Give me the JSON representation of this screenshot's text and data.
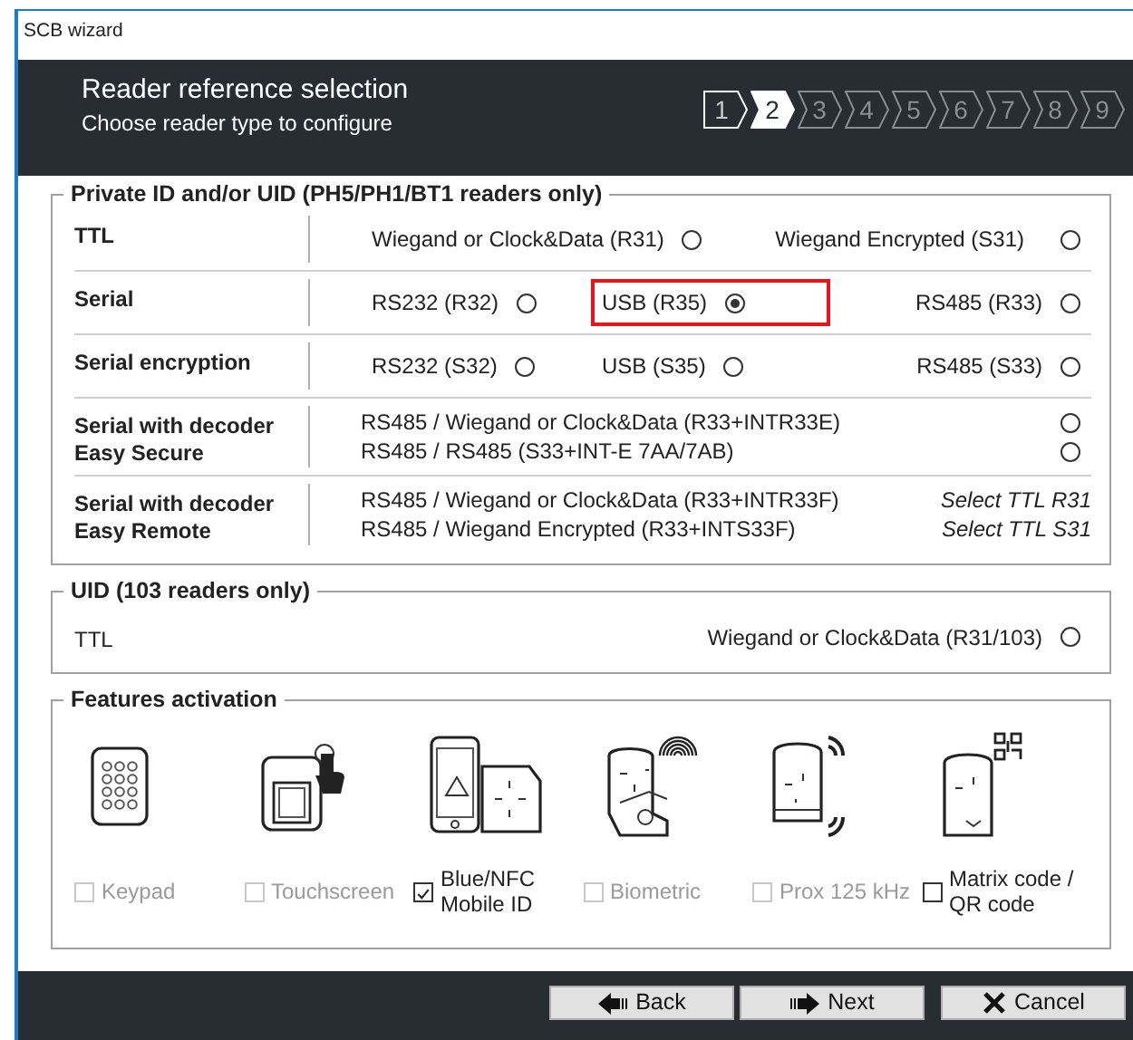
{
  "window": {
    "title": "SCB wizard"
  },
  "header": {
    "title": "Reader reference selection",
    "subtitle": "Choose reader type to configure",
    "steps": [
      {
        "label": "1",
        "completed": true,
        "selected": false
      },
      {
        "label": "2",
        "completed": false,
        "selected": true
      },
      {
        "label": "3",
        "completed": false,
        "selected": false
      },
      {
        "label": "4",
        "completed": false,
        "selected": false
      },
      {
        "label": "5",
        "completed": false,
        "selected": false
      },
      {
        "label": "6",
        "completed": false,
        "selected": false
      },
      {
        "label": "7",
        "completed": false,
        "selected": false
      },
      {
        "label": "8",
        "completed": false,
        "selected": false
      },
      {
        "label": "9",
        "completed": false,
        "selected": false
      }
    ]
  },
  "private_group": {
    "title": "Private ID and/or UID (PH5/PH1/BT1 readers only)",
    "rows": [
      {
        "kind": "inline",
        "label": "TTL",
        "options": [
          {
            "kind": "radio",
            "label": "Wiegand or Clock&Data (R31)",
            "selected": false
          },
          {
            "kind": "radio",
            "label": "Wiegand Encrypted (S31)",
            "selected": false
          }
        ]
      },
      {
        "kind": "inline",
        "label": "Serial",
        "options": [
          {
            "kind": "radio",
            "label": "RS232 (R32)",
            "selected": false
          },
          {
            "kind": "radio",
            "label": "USB (R35)",
            "selected": true,
            "highlighted": true
          },
          {
            "kind": "radio",
            "label": "RS485 (R33)",
            "selected": false
          }
        ]
      },
      {
        "kind": "inline",
        "label": "Serial encryption",
        "options": [
          {
            "kind": "radio",
            "label": "RS232 (S32)",
            "selected": false
          },
          {
            "kind": "radio",
            "label": "USB (S35)",
            "selected": false
          },
          {
            "kind": "radio",
            "label": "RS485 (S33)",
            "selected": false
          }
        ]
      },
      {
        "kind": "stacked",
        "label": "Serial with decoder\nEasy Secure",
        "options": [
          {
            "kind": "radio",
            "label": "RS485 / Wiegand or Clock&Data (R33+INTR33E)",
            "selected": false
          },
          {
            "kind": "radio",
            "label": "RS485 / RS485 (S33+INT-E 7AA/7AB)",
            "selected": false
          }
        ]
      },
      {
        "kind": "stacked",
        "label": "Serial with decoder\nEasy Remote",
        "options": [
          {
            "kind": "note",
            "label": "RS485 / Wiegand or Clock&Data (R33+INTR33F)",
            "note": "Select TTL R31"
          },
          {
            "kind": "note",
            "label": "RS485 / Wiegand Encrypted (R33+INTS33F)",
            "note": "Select TTL S31"
          }
        ]
      }
    ]
  },
  "uid_group": {
    "title": "UID (103 readers only)",
    "rows": [
      {
        "kind": "plain",
        "label": "TTL",
        "options": [
          {
            "kind": "radio",
            "label": "Wiegand or Clock&Data (R31/103)",
            "selected": false
          }
        ]
      }
    ]
  },
  "features": {
    "title": "Features activation",
    "items": [
      {
        "kind": "keypad",
        "label": "Keypad",
        "checked": false,
        "disabled": true
      },
      {
        "kind": "touchscreen",
        "label": "Touchscreen",
        "checked": false,
        "disabled": true
      },
      {
        "kind": "mobile",
        "label": "Blue/NFC\nMobile ID",
        "checked": true,
        "disabled": false
      },
      {
        "kind": "biometric",
        "label": "Biometric",
        "checked": false,
        "disabled": true
      },
      {
        "kind": "prox",
        "label": "Prox 125 kHz",
        "checked": false,
        "disabled": true
      },
      {
        "kind": "qr",
        "label": "Matrix code /\nQR code",
        "checked": false,
        "disabled": false
      }
    ]
  },
  "buttons": [
    {
      "kind": "back",
      "label": "Back"
    },
    {
      "kind": "next",
      "label": "Next"
    },
    {
      "kind": "cancel",
      "label": "Cancel"
    }
  ]
}
